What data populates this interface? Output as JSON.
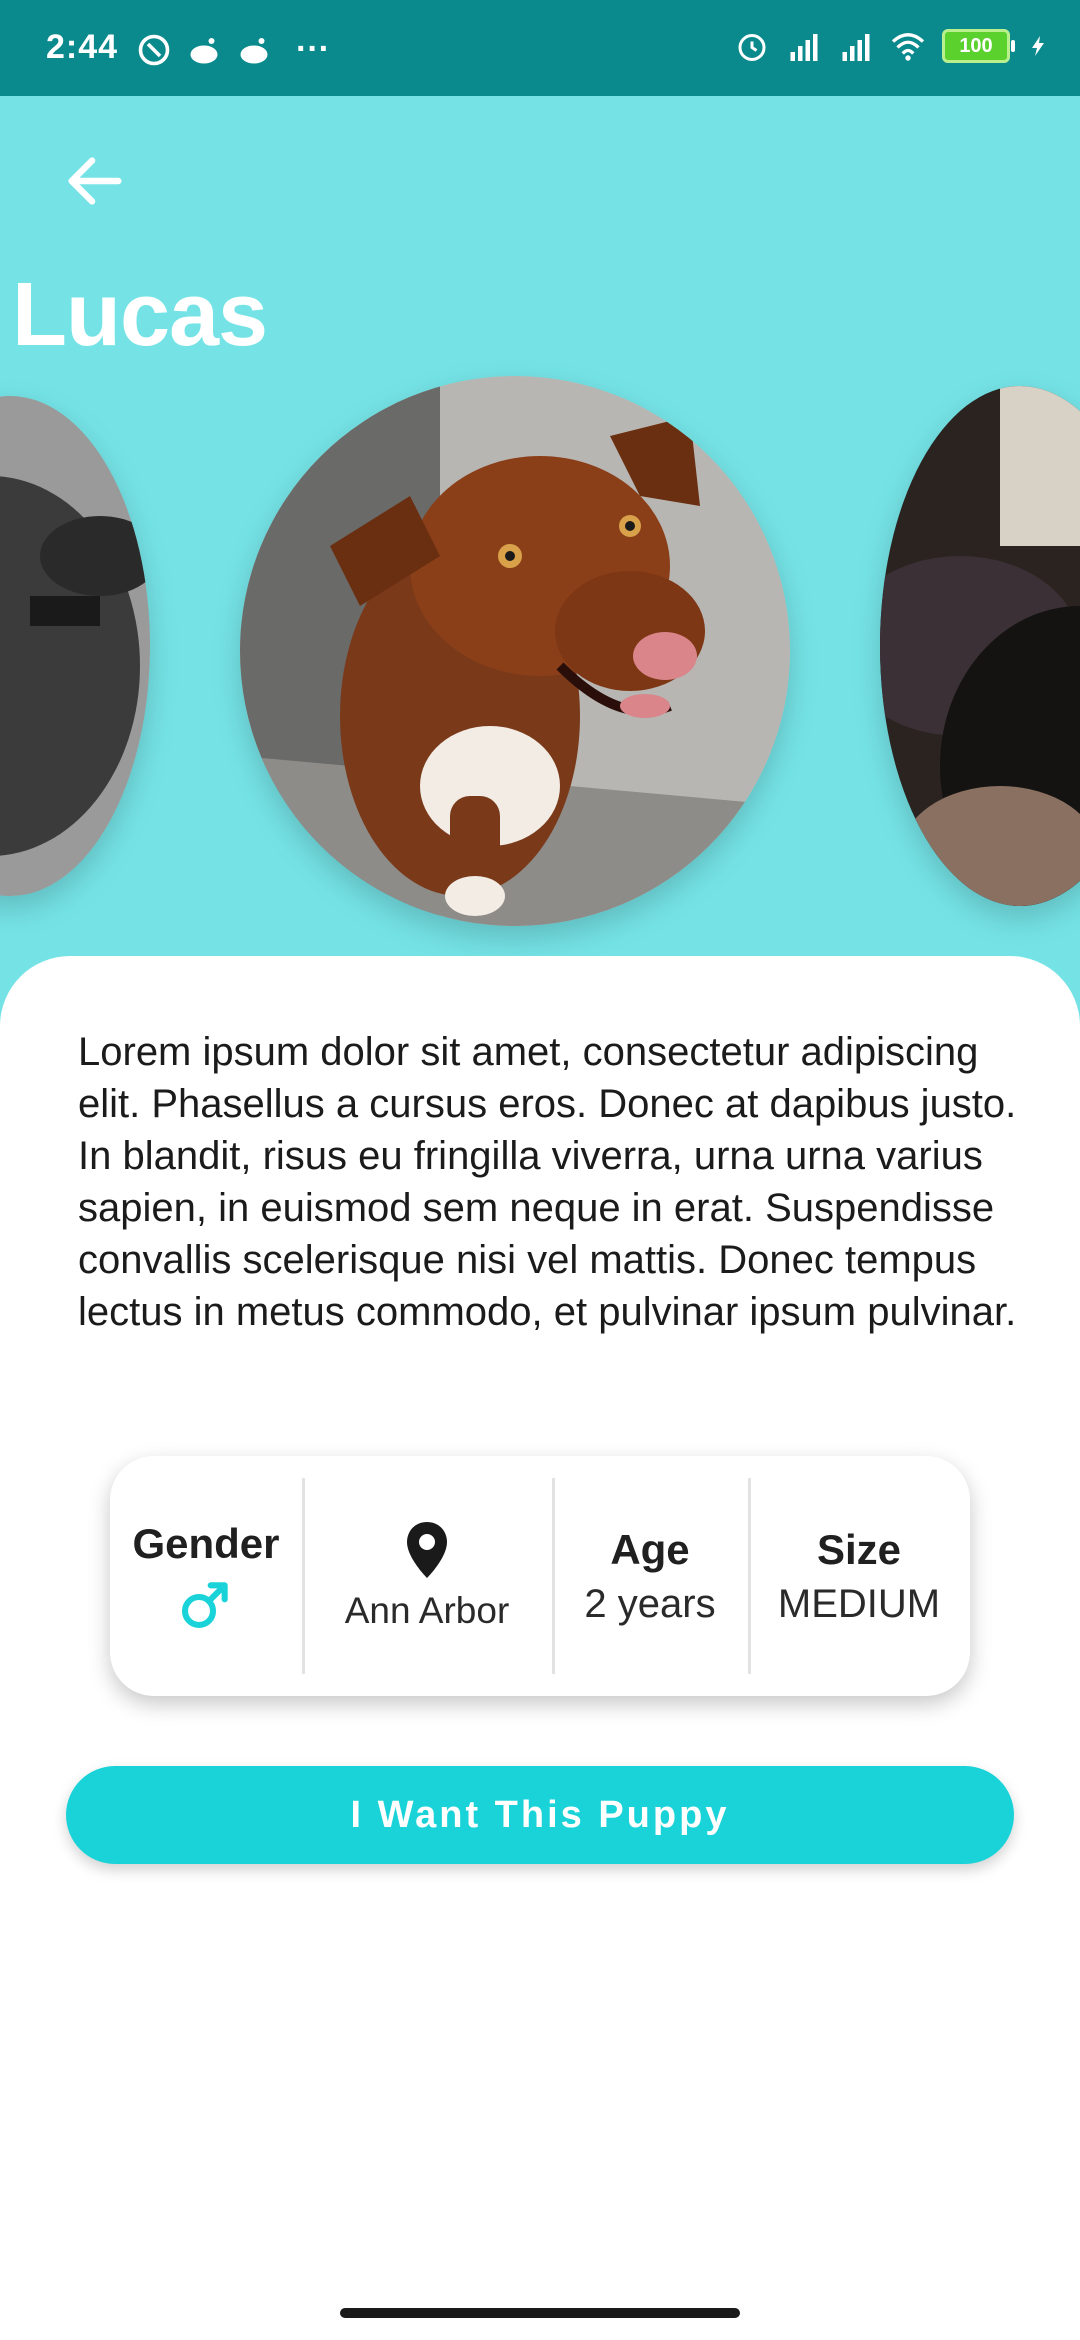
{
  "status_bar": {
    "time": "2:44",
    "battery": "100",
    "overflow": "···"
  },
  "pet": {
    "name": "Lucas",
    "description": "Lorem ipsum dolor sit amet, consectetur adipiscing elit. Phasellus a cursus eros. Donec at dapibus justo. In blandit, risus eu fringilla viverra, urna urna varius sapien, in euismod sem neque in erat. Suspendisse convallis scelerisque nisi vel mattis. Donec tempus lectus in metus commodo, et pulvinar ipsum pulvinar."
  },
  "info": {
    "gender_label": "Gender",
    "gender_icon": "male-icon",
    "location_icon": "location-pin-icon",
    "location": "Ann Arbor",
    "age_label": "Age",
    "age_value": "2 years",
    "size_label": "Size",
    "size_value": "MEDIUM"
  },
  "cta": {
    "label": "I Want This Puppy"
  },
  "colors": {
    "status_bar": "#0a8a8c",
    "header_bg": "#75e3e6",
    "accent": "#1ad3d8"
  }
}
